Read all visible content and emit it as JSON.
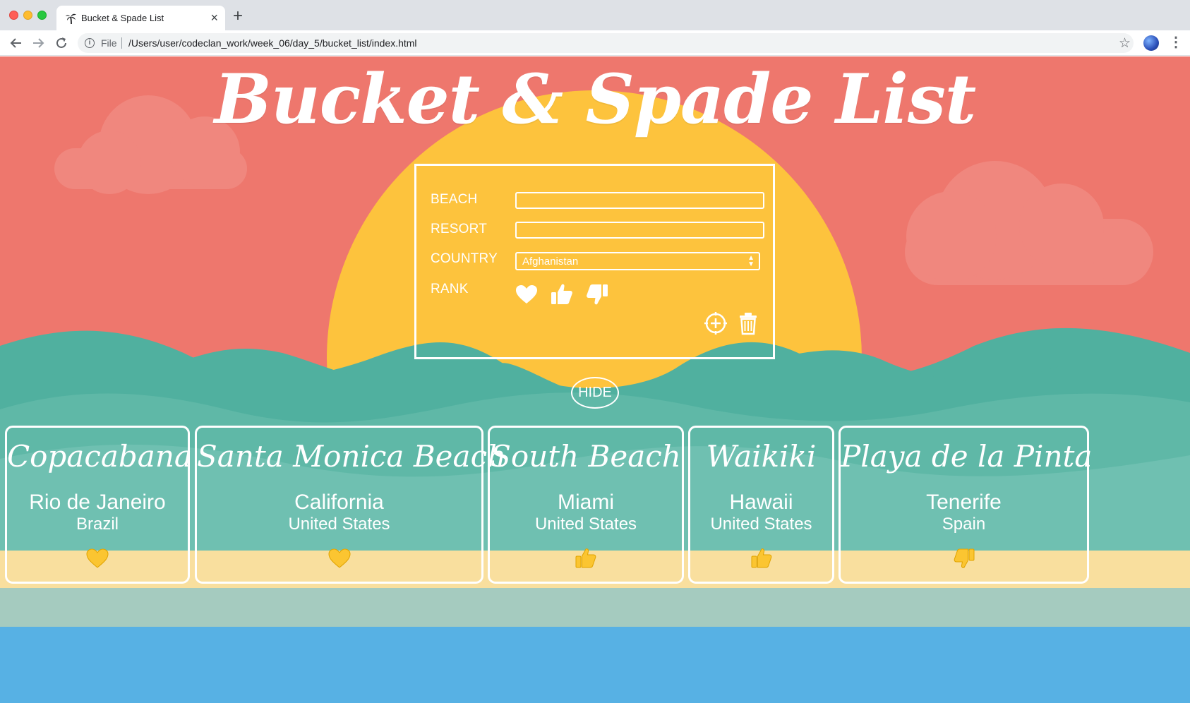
{
  "browser": {
    "tab_title": "Bucket & Spade List",
    "new_tab_symbol": "+",
    "tab_close_symbol": "×",
    "address_scheme_label": "File",
    "url": "/Users/user/codeclan_work/week_06/day_5/bucket_list/index.html",
    "menu_symbol": "⋮",
    "star_symbol": "☆"
  },
  "page": {
    "title": "Bucket & Spade List"
  },
  "form": {
    "beach_label": "BEACH",
    "resort_label": "RESORT",
    "country_label": "COUNTRY",
    "rank_label": "RANK",
    "beach_value": "",
    "resort_value": "",
    "country_selected": "Afghanistan",
    "rank_icons": [
      "heart-icon",
      "thumbs-up-icon",
      "thumbs-down-icon"
    ],
    "action_icons": [
      "add-circle-icon",
      "trash-icon"
    ]
  },
  "hide_button": {
    "label": "HIDE"
  },
  "cards": [
    {
      "beach": "Copacabana",
      "resort": "Rio de Janeiro",
      "country": "Brazil",
      "rank": "heart"
    },
    {
      "beach": "Santa Monica Beach",
      "resort": "California",
      "country": "United States",
      "rank": "heart"
    },
    {
      "beach": "South Beach",
      "resort": "Miami",
      "country": "United States",
      "rank": "thumbs-up"
    },
    {
      "beach": "Waikiki",
      "resort": "Hawaii",
      "country": "United States",
      "rank": "thumbs-up"
    },
    {
      "beach": "Playa de la Pinta",
      "resort": "Tenerife",
      "country": "Spain",
      "rank": "thumbs-down"
    }
  ],
  "colors": {
    "sky": "#ee776d",
    "cloud": "#f0877e",
    "sun": "#fdc33d",
    "sea_dark": "#50b09f",
    "sea_light": "#6fc0b1",
    "sand": "#f9df9e",
    "shore": "#a5cbbf",
    "water": "#57b1e4",
    "white": "#ffffff",
    "emoji_yellow": "#fbc531"
  }
}
